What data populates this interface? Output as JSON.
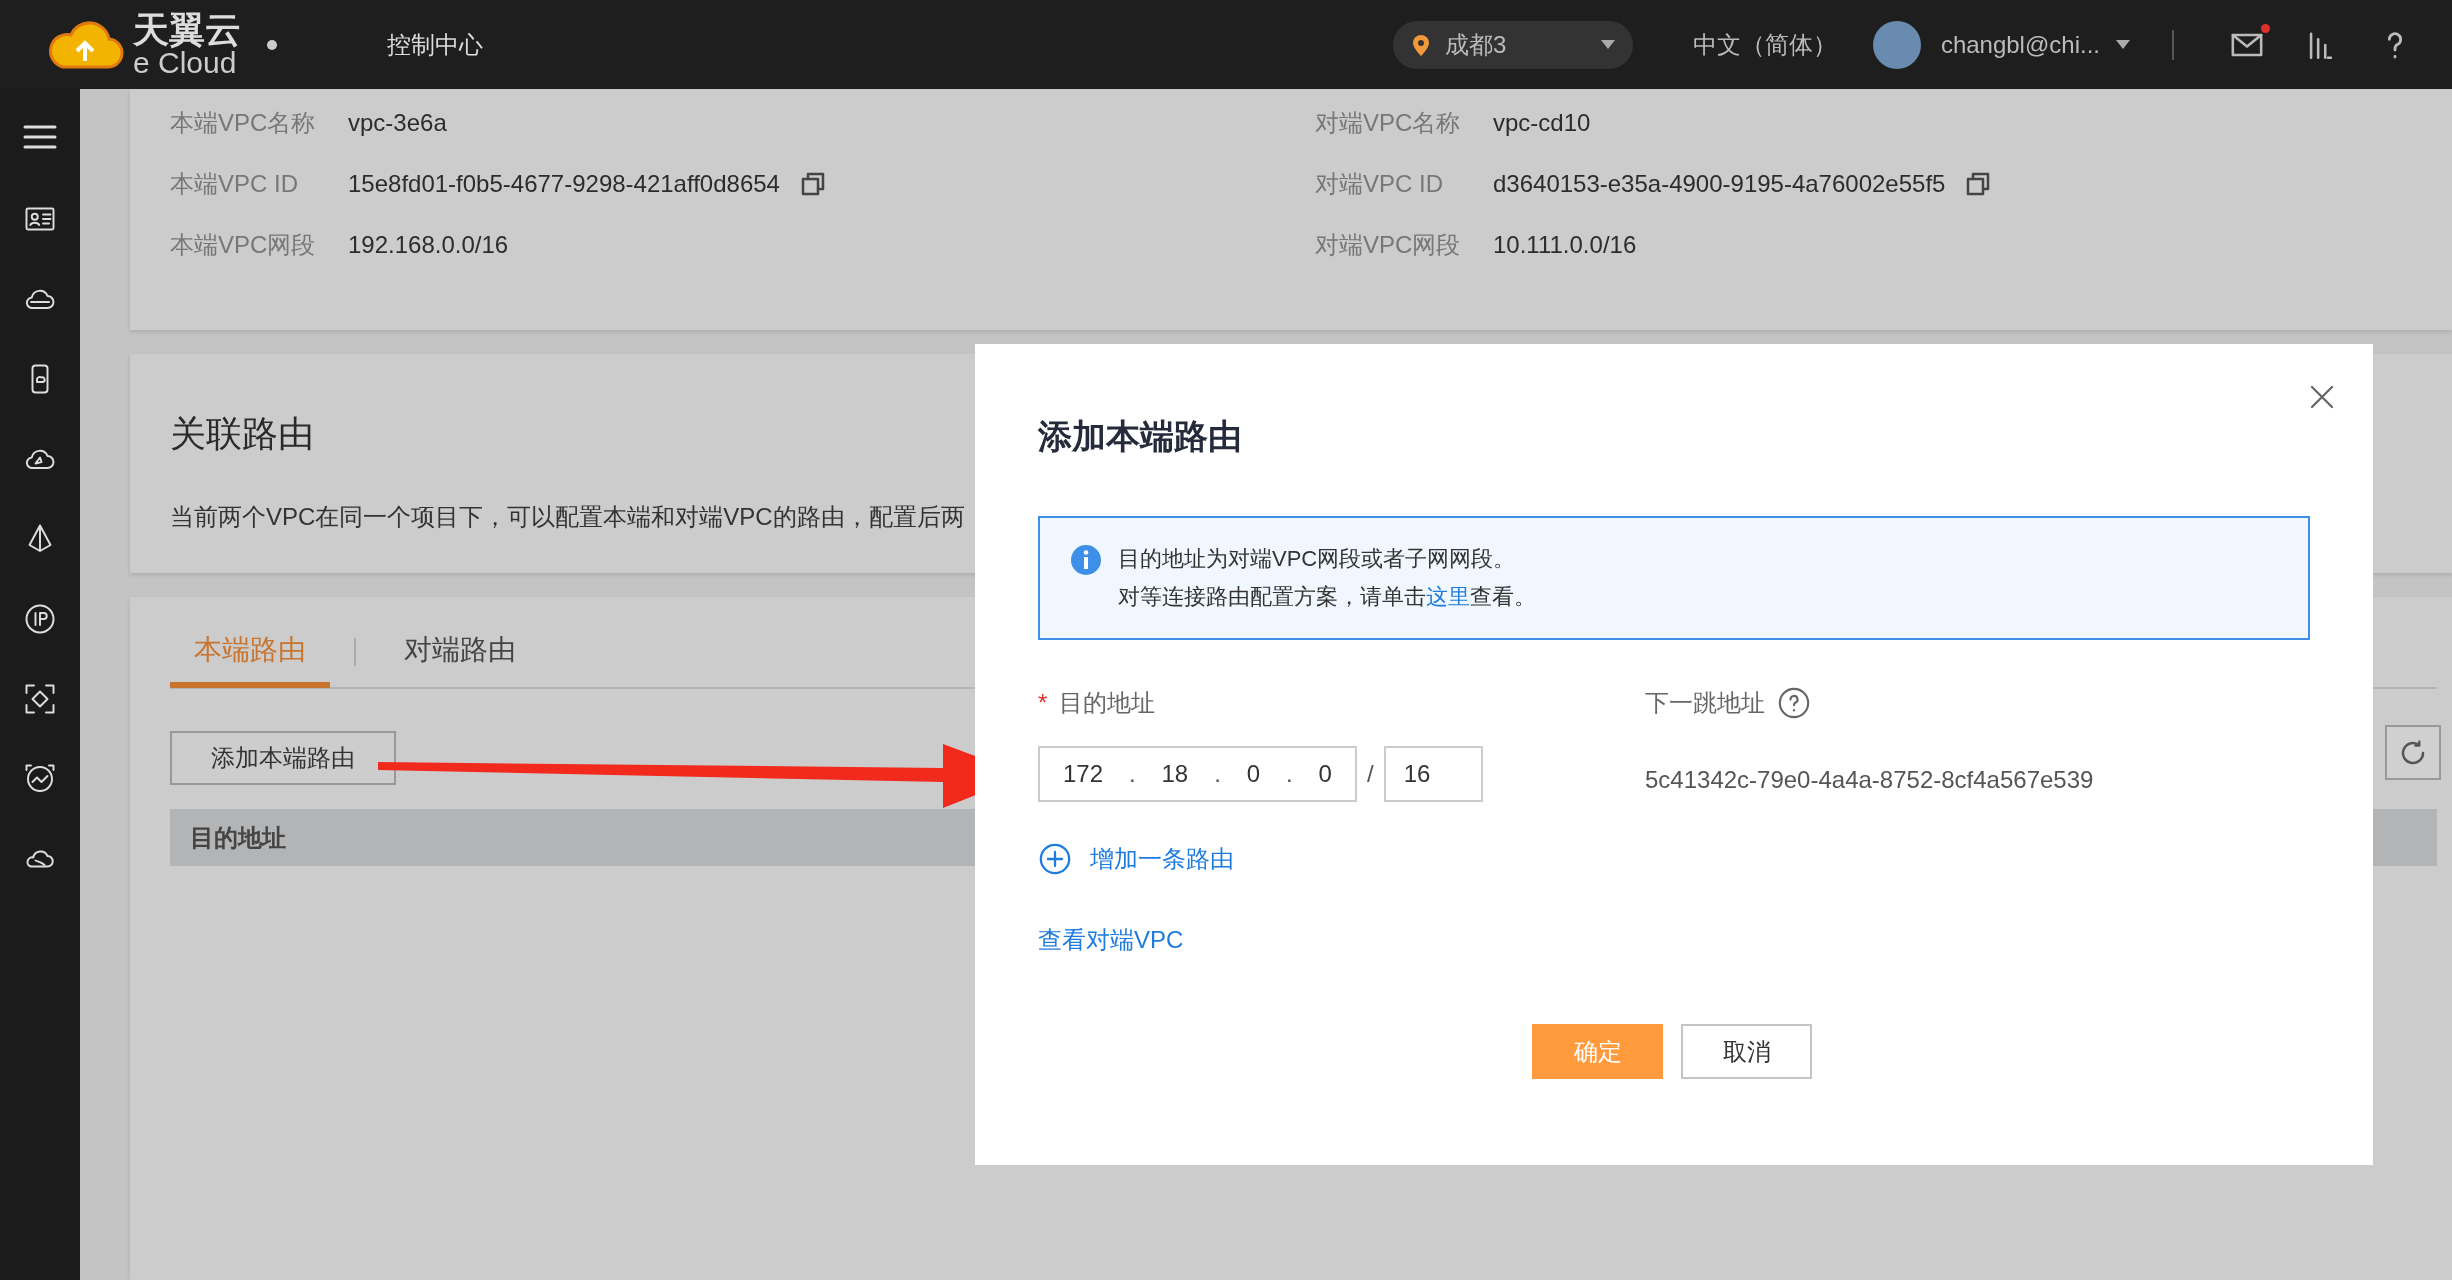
{
  "topbar": {
    "logo_name": "天翼云",
    "logo_subtitle": "e Cloud",
    "nav_title": "控制中心",
    "region": "成都3",
    "language": "中文（简体）",
    "user": "changbl@chi...",
    "mail_unread": true
  },
  "vpc_info": {
    "local": [
      {
        "label": "本端VPC名称",
        "value": "vpc-3e6a",
        "copyable": false
      },
      {
        "label": "本端VPC ID",
        "value": "15e8fd01-f0b5-4677-9298-421aff0d8654",
        "copyable": true
      },
      {
        "label": "本端VPC网段",
        "value": "192.168.0.0/16",
        "copyable": false
      }
    ],
    "peer": [
      {
        "label": "对端VPC名称",
        "value": "vpc-cd10",
        "copyable": false
      },
      {
        "label": "对端VPC ID",
        "value": "d3640153-e35a-4900-9195-4a76002e55f5",
        "copyable": true
      },
      {
        "label": "对端VPC网段",
        "value": "10.111.0.0/16",
        "copyable": false
      }
    ]
  },
  "route_section": {
    "title": "关联路由",
    "description": "当前两个VPC在同一个项目下，可以配置本端和对端VPC的路由，配置后两"
  },
  "tabs": [
    {
      "label": "本端路由",
      "selected": true
    },
    {
      "label": "对端路由",
      "selected": false
    }
  ],
  "add_button": "添加本端路由",
  "table": {
    "columns": [
      "目的地址"
    ]
  },
  "dialog": {
    "title": "添加本端路由",
    "notice": {
      "line_1": "目的地址为对端VPC网段或者子网网段。",
      "line_2_before": "对等连接路由配置方案，请单击",
      "line_2_link": "这里",
      "line_2_after": "查看。"
    },
    "destination": {
      "required_mark": "*",
      "label": "目的地址",
      "octets": [
        "172",
        "18",
        "0",
        "0"
      ],
      "separator": ".",
      "mask_separator": "/",
      "mask": "16"
    },
    "next_hop": {
      "label": "下一跳地址",
      "value": "5c41342c-79e0-4a4a-8752-8cf4a567e539"
    },
    "add_route": "增加一条路由",
    "view_peer": "查看对端VPC",
    "buttons": [
      {
        "label": "确定",
        "kind": "primary"
      },
      {
        "label": "取消",
        "kind": "secondary"
      }
    ]
  }
}
